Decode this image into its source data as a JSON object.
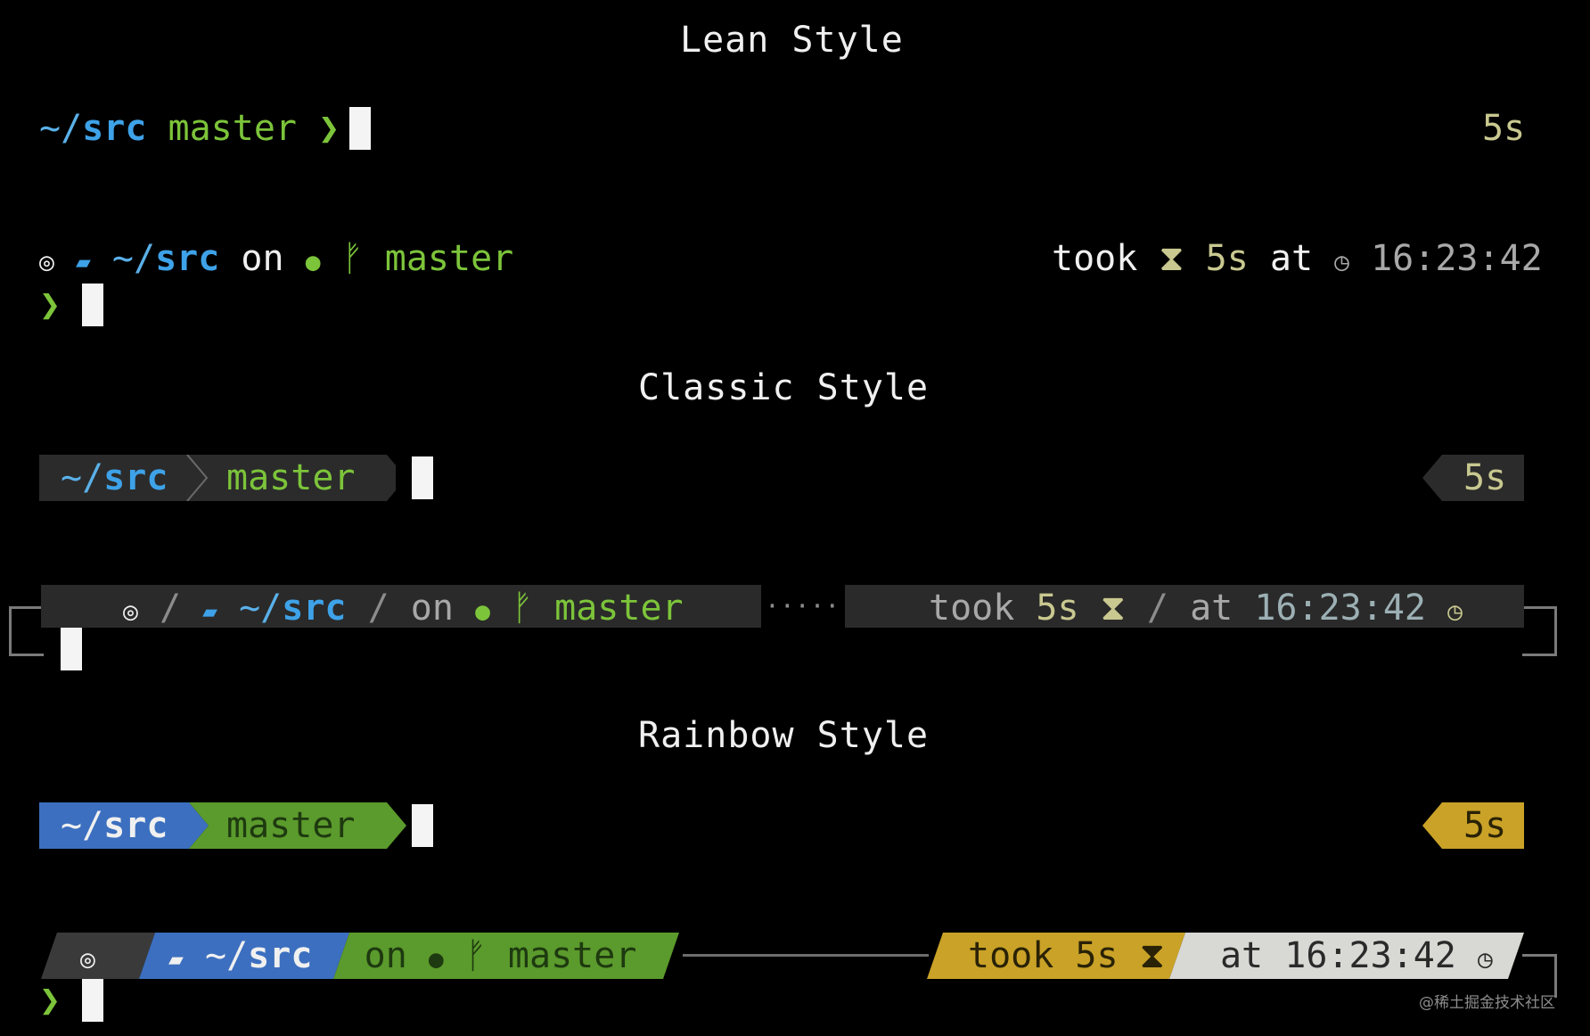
{
  "lean": {
    "title": "Lean Style",
    "line1": {
      "dir_prefix": "~/",
      "dir": "src",
      "branch": "master",
      "prompt_char": "❯",
      "duration": "5s"
    },
    "line2": {
      "os_icon": "ubuntu-icon",
      "folder_icon": "folder-icon",
      "dir_prefix": "~/",
      "dir": "src",
      "on": "on",
      "git_icon": "github-icon",
      "branch_icon": "branch-icon",
      "branch": "master",
      "took": "took",
      "hourglass_icon": "hourglass-icon",
      "duration": "5s",
      "at": "at",
      "clock_icon": "clock-icon",
      "time": "16:23:42",
      "prompt_char": "❯"
    }
  },
  "classic": {
    "title": "Classic Style",
    "line1": {
      "dir_prefix": "~/",
      "dir": "src",
      "branch": "master",
      "duration": "5s"
    },
    "line2": {
      "dir_prefix": "~/",
      "dir": "src",
      "on": "on",
      "branch": "master",
      "filler": "·····",
      "took": "took",
      "duration": "5s",
      "at": "at",
      "time": "16:23:42"
    }
  },
  "rainbow": {
    "title": "Rainbow Style",
    "line1": {
      "dir_prefix": "~/",
      "dir": "src",
      "branch": "master",
      "duration": "5s"
    },
    "line2": {
      "dir_prefix": "~/",
      "dir": "src",
      "on": "on",
      "branch": "master",
      "took": "took",
      "duration": "5s",
      "at": "at",
      "time": "16:23:42",
      "prompt_char": "❯"
    }
  },
  "watermark": "@稀土掘金技术社区",
  "colors": {
    "background": "#000000",
    "dir_blue": "#3ea2e8",
    "branch_green": "#7cc43a",
    "classic_segment": "#2b2b2b",
    "rainbow_blue": "#3c6fbf",
    "rainbow_green": "#5b9a2c",
    "rainbow_gold": "#c9a227",
    "rainbow_light": "#d8d8d4",
    "rainbow_dark": "#3a3a3a"
  }
}
